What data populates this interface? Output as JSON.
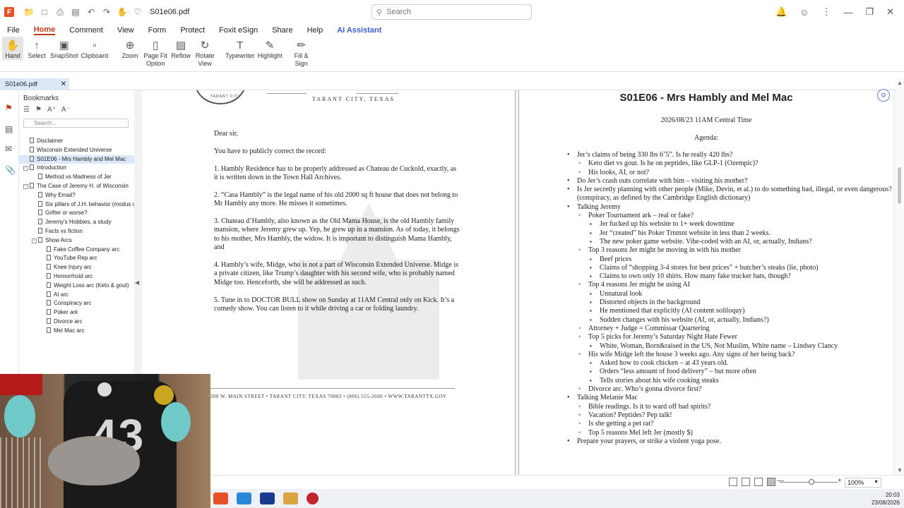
{
  "app": {
    "file_name": "S01e06.pdf",
    "search_placeholder": "Search"
  },
  "menu": [
    "File",
    "Home",
    "Comment",
    "View",
    "Form",
    "Protect",
    "Foxit eSign",
    "Share",
    "Help",
    "AI Assistant"
  ],
  "ribbon": [
    {
      "label": "Hand",
      "icon": "hand-icon"
    },
    {
      "label": "Select",
      "icon": "select-icon"
    },
    {
      "label": "SnapShot",
      "icon": "snapshot-icon"
    },
    {
      "label": "Clipboard",
      "icon": "clipboard-icon"
    },
    {
      "label": "Zoom",
      "icon": "zoom-icon"
    },
    {
      "label": "Page Fit Option",
      "icon": "page-fit-icon"
    },
    {
      "label": "Reflow",
      "icon": "reflow-icon"
    },
    {
      "label": "Rotate View",
      "icon": "rotate-icon"
    },
    {
      "label": "Typewriter",
      "icon": "typewriter-icon"
    },
    {
      "label": "Highlight",
      "icon": "highlight-icon"
    },
    {
      "label": "Fill & Sign",
      "icon": "fill-sign-icon"
    }
  ],
  "doc_tab": "S01e06.pdf",
  "bookmarks": {
    "title": "Bookmarks",
    "search_placeholder": "Search...",
    "items": [
      {
        "label": "Disclaimer",
        "level": 0
      },
      {
        "label": "Wisconsin Extended Universe",
        "level": 0
      },
      {
        "label": "S01E06 - Mrs Hambly and Mel Mac",
        "level": 0,
        "selected": true
      },
      {
        "label": "Introduction",
        "level": 0,
        "toggle": "-"
      },
      {
        "label": "Method vs Madness of Jer",
        "level": 1
      },
      {
        "label": "The Case of Jeremy H. of Wisconsin",
        "level": 0,
        "toggle": "-"
      },
      {
        "label": "Why Email?",
        "level": 1
      },
      {
        "label": "Six pillars of J.H. behavior (modus o",
        "level": 1
      },
      {
        "label": "Grifter or worse?",
        "level": 1
      },
      {
        "label": "Jeremy's Hobbies, a study",
        "level": 1
      },
      {
        "label": "Facts vs fiction",
        "level": 1
      },
      {
        "label": "Show Arcs",
        "level": 1,
        "toggle": "-"
      },
      {
        "label": "Fake Coffee Company arc",
        "level": 2
      },
      {
        "label": "YouTube Rep arc",
        "level": 2
      },
      {
        "label": "Knee Injury arc",
        "level": 2
      },
      {
        "label": "Hemorrhoid arc",
        "level": 2
      },
      {
        "label": "Weight Loss arc (Keto & gout)",
        "level": 2
      },
      {
        "label": "AI arc",
        "level": 2
      },
      {
        "label": "Conspiracy arc",
        "level": 2
      },
      {
        "label": "Poker ark",
        "level": 2
      },
      {
        "label": "Divorce arc",
        "level": 2
      },
      {
        "label": "Mel Mac arc",
        "level": 2
      }
    ]
  },
  "page1": {
    "city_header": "TARANT CITY, TEXAS",
    "greeting": "Dear sir,",
    "paragraphs": [
      "You have to publicly correct the record:",
      "1. Hambly Residence has to be properly addressed as Chateau de Cuckold, exactly, as it is written down in the Town Hall Archives.",
      "2. “Casa Hambly” is the legal name of his old 2000 sq ft house that does not belong to Mr Hambly any more. He misses it sometimes.",
      "3. Chateau d’Hambly, also known as the Old Mama House, is the old Hambly family mansion, where Jeremy grew up. Yep, he grew up in a mansion. As of today, it belongs to his mother, Mrs Hambly, the widow. It is important to distinguish Mama Hambly, and",
      "4. Hambly’s wife, Midge, who is not a part of Wisconsin Extended Universe. Midge is a private citizen, like Trump’s daughter with his second wife, who is probably named Midge too. Henceforth, she will be addressed as such.",
      "5. Tune in to DOCTOR BULL show on Sunday at 11AM Central only on Kick. It’s a comedy show. You can listen to it while driving a car or folding laundry."
    ],
    "footer": "200 W. MAIN STREET  •  TARANT CITY, TEXAS 79083  •  (806) 555-2600  •  WWW.TARANTTX.GOV"
  },
  "page2": {
    "title": "S01E06 - Mrs Hambly and Mel Mac",
    "date": "2026/08/23 11AM Central Time",
    "agenda_label": "Agenda:",
    "items": [
      {
        "lvl": 1,
        "text": "Jer’s claims of being 330 lbs 6’5”. Is he really 420 lbs?"
      },
      {
        "lvl": 2,
        "text": "Keto diet vs gout. Is he on peptides, like GLP-1 (Ozempic)?"
      },
      {
        "lvl": 2,
        "text": "His looks, AI, or not?"
      },
      {
        "lvl": 1,
        "text": "Do Jer’s crash outs correlate with him – visiting his mother?"
      },
      {
        "lvl": 1,
        "text": "Is Jer secretly planning with other people (Mike, Devin, et al.) to do something bad, illegal, or even dangerous? (conspiracy, as defined by the Cambridge English dictionary)"
      },
      {
        "lvl": 1,
        "text": "Talking Jeremy"
      },
      {
        "lvl": 2,
        "text": "Poker Tournament ark – real or fake?"
      },
      {
        "lvl": 3,
        "text": "Jer fucked up his website to 1+ week downtime"
      },
      {
        "lvl": 3,
        "text": "Jer “created” his Poker Trnmnt website in less than 2 weeks."
      },
      {
        "lvl": 3,
        "text": "The new poker game website. Vibe-coded with an AI, or, actually, Indians?"
      },
      {
        "lvl": 2,
        "text": "Top 3 reasons Jer might be moving in with his mother"
      },
      {
        "lvl": 3,
        "text": "Beef prices"
      },
      {
        "lvl": 3,
        "text": "Claims of “shopping 3-4 stores for best prices” + butcher’s steaks (lie, photo)"
      },
      {
        "lvl": 3,
        "text": "Claims to own only 10 shirts. How many fake trucker hats, though?"
      },
      {
        "lvl": 2,
        "text": "Top 4 reasons Jer might be using AI"
      },
      {
        "lvl": 3,
        "text": "Unnatural look"
      },
      {
        "lvl": 3,
        "text": "Distorted objects in the background"
      },
      {
        "lvl": 3,
        "text": "He mentioned that explicitly (AI content soliloquy)"
      },
      {
        "lvl": 3,
        "text": "Sudden changes with his website (AI, or, actually, Indians?)"
      },
      {
        "lvl": 2,
        "text": "Attorney + Judge = Commissar Quartering"
      },
      {
        "lvl": 2,
        "text": "Top 5 picks for Jeremy’s Saturday Night Hate Fewer"
      },
      {
        "lvl": 3,
        "text": "White, Woman, Born&raised in the US, Not Muslim, White name – Lindsey Clancy"
      },
      {
        "lvl": 2,
        "text": "His wife Midge left the house 3 weeks ago. Any signs of her being back?"
      },
      {
        "lvl": 3,
        "text": "Asked how to cook chicken – at 43 years old."
      },
      {
        "lvl": 3,
        "text": "Orders “less amount of food delivery” – but more often"
      },
      {
        "lvl": 3,
        "text": "Tells stories about his wife cooking steaks"
      },
      {
        "lvl": 2,
        "text": "Divorce arc. Who’s gonna divorce first?"
      },
      {
        "lvl": 1,
        "text": "Talking Melanie Mac"
      },
      {
        "lvl": 2,
        "text": "Bible readings. Is it to ward off bad spirits?"
      },
      {
        "lvl": 2,
        "text": "Vacation? Peptides? Pep talk!"
      },
      {
        "lvl": 2,
        "text": "Is she getting a pet rat?"
      },
      {
        "lvl": 2,
        "text": "Top 5 reasons Mel left Jer (mostly $)"
      },
      {
        "lvl": 1,
        "text": "Prepare your prayers, or strike a violent yoga pose."
      }
    ]
  },
  "status": {
    "zoom": "100%"
  },
  "taskbar": {
    "time": "20:03",
    "date": "23/08/2026"
  },
  "webcam": {
    "jersey_number": "43"
  },
  "colors": {
    "accent": "#c33b1b",
    "ai": "#3a5ec7",
    "tab_bg": "#dbe8f7"
  }
}
